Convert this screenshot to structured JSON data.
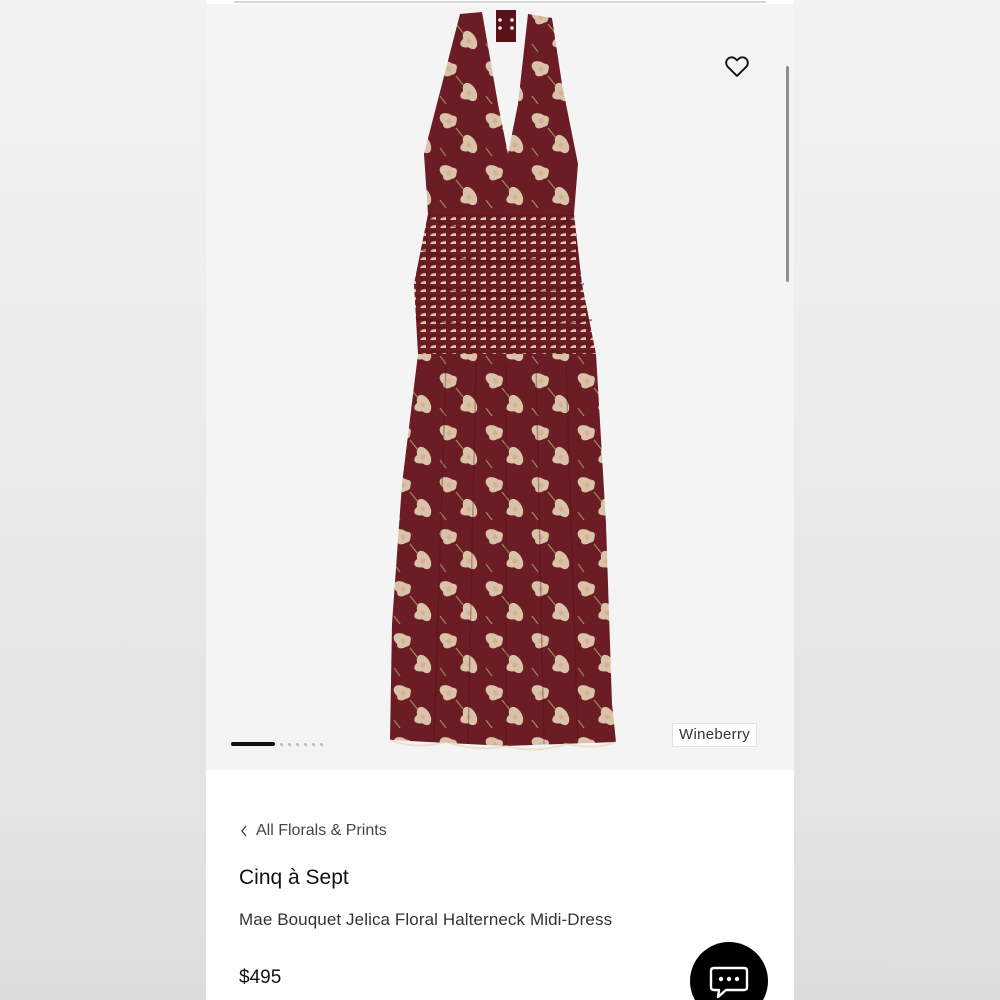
{
  "product": {
    "color_label": "Wineberry",
    "breadcrumb": "All Florals & Prints",
    "brand": "Cinq à Sept",
    "name": "Mae Bouquet Jelica Floral Halterneck Midi-Dress",
    "price": "$495"
  },
  "gallery": {
    "image_count": 8,
    "active_index": 0
  },
  "icons": {
    "wishlist": "heart-icon",
    "back": "chevron-left-icon",
    "chat": "chat-bubble-icon"
  },
  "colors": {
    "dress_base": "#6b1c24",
    "floral": "#e6d6b8",
    "chat_button": "#000000",
    "active_dot": "#111111"
  }
}
